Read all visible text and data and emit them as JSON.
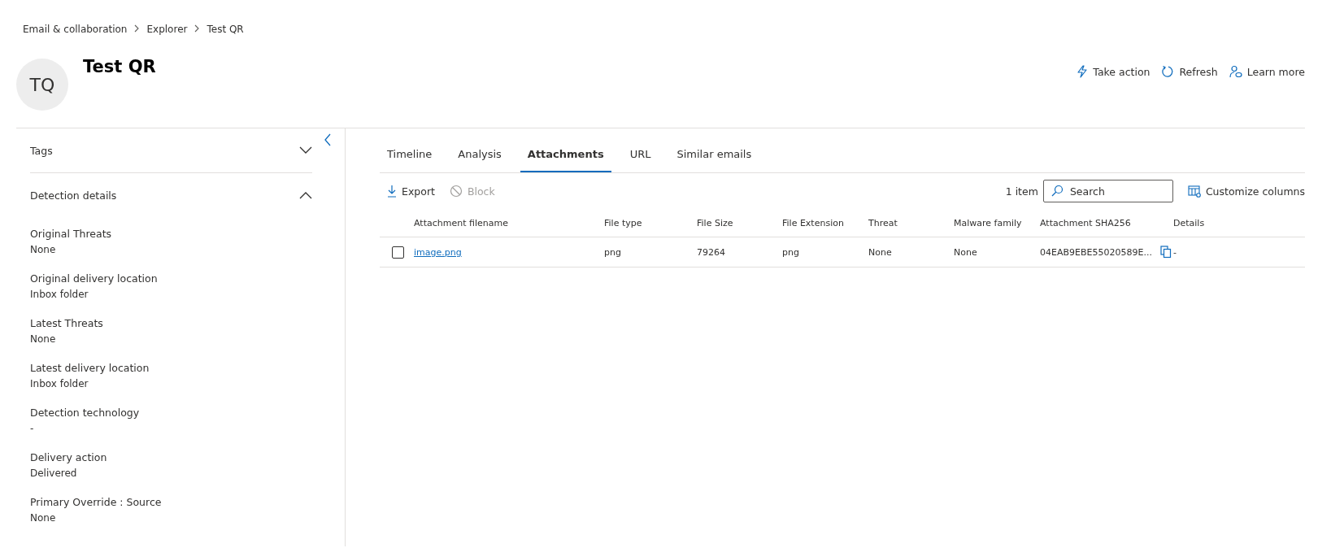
{
  "breadcrumb": [
    "Email & collaboration",
    "Explorer",
    "Test QR"
  ],
  "header": {
    "avatar_initials": "TQ",
    "title": "Test QR",
    "actions": [
      {
        "kind": "bolt",
        "label": "Take action"
      },
      {
        "kind": "refresh",
        "label": "Refresh"
      },
      {
        "kind": "learn",
        "label": "Learn more"
      }
    ]
  },
  "sidebar": {
    "sections": [
      {
        "title": "Tags",
        "expanded": false
      },
      {
        "title": "Detection details",
        "expanded": true
      }
    ],
    "fields": [
      {
        "label": "Original Threats",
        "value": "None"
      },
      {
        "label": "Original delivery location",
        "value": "Inbox folder"
      },
      {
        "label": "Latest Threats",
        "value": "None"
      },
      {
        "label": "Latest delivery location",
        "value": "Inbox folder"
      },
      {
        "label": "Detection technology",
        "value": "-"
      },
      {
        "label": "Delivery action",
        "value": "Delivered"
      },
      {
        "label": "Primary Override : Source",
        "value": "None"
      }
    ]
  },
  "tabs": [
    {
      "label": "Timeline",
      "selected": false
    },
    {
      "label": "Analysis",
      "selected": false
    },
    {
      "label": "Attachments",
      "selected": true
    },
    {
      "label": "URL",
      "selected": false
    },
    {
      "label": "Similar emails",
      "selected": false
    }
  ],
  "toolbar": {
    "buttons": [
      {
        "kind": "export",
        "label": "Export",
        "disabled": false
      },
      {
        "kind": "block",
        "label": "Block",
        "disabled": true
      }
    ],
    "count": "1 item",
    "search": {
      "placeholder": "Search"
    },
    "customize": "Customize columns"
  },
  "table": {
    "columns": [
      "Attachment filename",
      "File type",
      "File Size",
      "File Extension",
      "Threat",
      "Malware family",
      "Attachment SHA256",
      "Details"
    ],
    "rows": [
      {
        "checked": false,
        "cells": [
          "image.png",
          "png",
          "79264",
          "png",
          "None",
          "None",
          "04EAB9EBE55020589E...",
          "-"
        ]
      }
    ]
  }
}
